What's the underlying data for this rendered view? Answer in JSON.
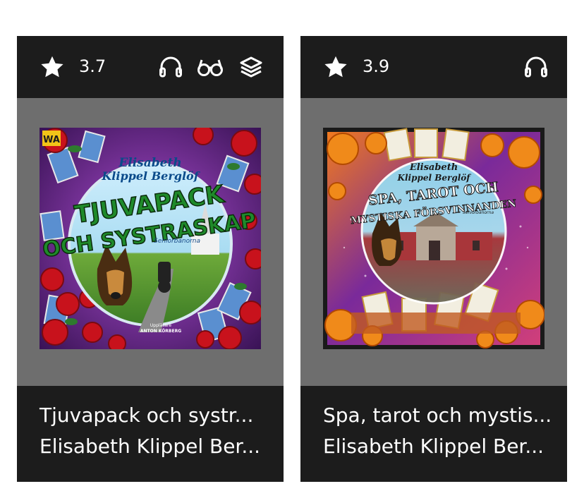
{
  "books": [
    {
      "rating": "3.7",
      "title": "Tjuvapack och systr...",
      "author": "Elisabeth Klippel Ber...",
      "formats": [
        "headphones-icon",
        "glasses-icon",
        "layers-icon"
      ],
      "cover": {
        "author_line1": "Elisabeth",
        "author_line2": "Klippel Berglöf",
        "title_line1": "TJUVAPACK",
        "title_line2": "OCH SYSTRASKAP",
        "series": "Seniorbanorna",
        "reader_label": "Uppläsare",
        "reader_name": "ANTON KÖRBERG",
        "publisher": "WA"
      }
    },
    {
      "rating": "3.9",
      "title": "Spa, tarot och mystis...",
      "author": "Elisabeth Klippel Ber...",
      "formats": [
        "headphones-icon"
      ],
      "cover": {
        "author_line1": "Elisabeth",
        "author_line2": "Klippel Berglöf",
        "title_line1": "SPA, TAROT OCH",
        "title_line2": "MYSTISKA FÖRSVINNANDEN",
        "series": "Seniorbanorna"
      }
    }
  ],
  "colors": {
    "card_bg": "#1c1c1c",
    "cover_area_bg": "#6e6e6e",
    "text": "#ffffff"
  }
}
